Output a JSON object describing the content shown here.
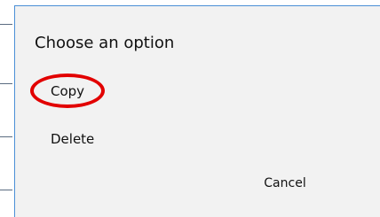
{
  "dialog": {
    "title": "Choose an option",
    "options": [
      {
        "label": "Copy",
        "highlighted": true
      },
      {
        "label": "Delete",
        "highlighted": false
      }
    ],
    "cancel_label": "Cancel"
  },
  "colors": {
    "dialog_background": "#f2f2f2",
    "dialog_border": "#4a8fd6",
    "highlight_ring": "#e20000",
    "text": "#111111"
  }
}
